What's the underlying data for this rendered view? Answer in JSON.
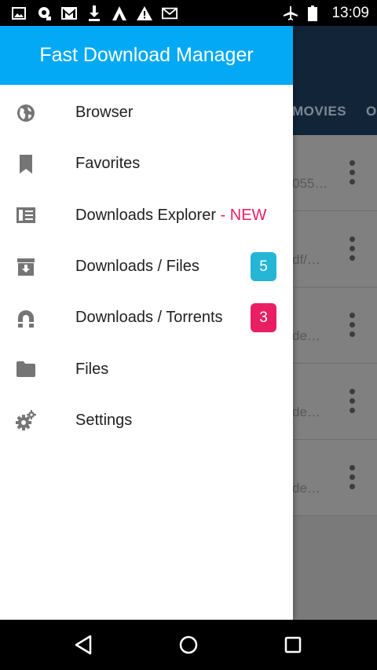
{
  "status_bar": {
    "time": "13:09",
    "left_icons": [
      "image-icon",
      "sync-icon",
      "gmail-icon",
      "download-icon",
      "app-icon",
      "warning-icon",
      "mail-icon"
    ],
    "right_icons": [
      "airplane-icon",
      "battery-icon"
    ]
  },
  "background": {
    "tabs": [
      "MOVIES",
      "O"
    ],
    "rows": [
      "055…",
      "df/…",
      "de…",
      "de…",
      "de…"
    ]
  },
  "drawer": {
    "title": "Fast Download Manager",
    "items": [
      {
        "label": "Browser",
        "icon": "globe-icon"
      },
      {
        "label": "Favorites",
        "icon": "bookmark-icon"
      },
      {
        "label": "Downloads Explorer",
        "suffix": " - NEW",
        "icon": "explorer-icon"
      },
      {
        "label": "Downloads / Files",
        "icon": "download-box-icon",
        "badge": "5",
        "badge_color": "#26b5d4"
      },
      {
        "label": "Downloads / Torrents",
        "icon": "magnet-icon",
        "badge": "3",
        "badge_color": "#e91e63"
      },
      {
        "label": "Files",
        "icon": "folder-icon"
      },
      {
        "label": "Settings",
        "icon": "settings-icon"
      }
    ]
  },
  "colors": {
    "header": "#03a9f4",
    "new_accent": "#e91e63",
    "icon": "#757575"
  },
  "nav_bar": [
    "back-button",
    "home-button",
    "recents-button"
  ]
}
